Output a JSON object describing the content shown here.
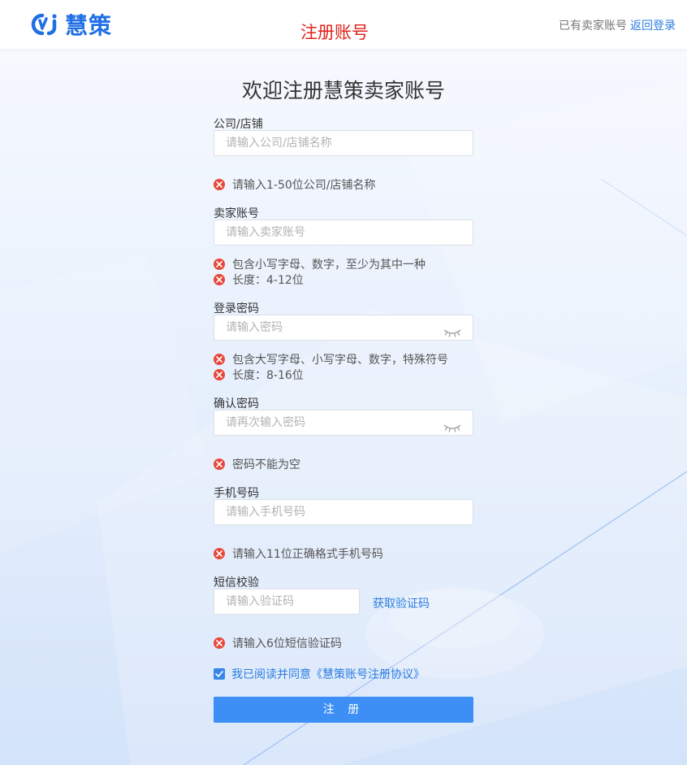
{
  "header": {
    "logo_text": "慧策",
    "title": "注册账号",
    "have_account_text": "已有卖家账号",
    "back_login_link": "返回登录"
  },
  "page_title": "欢迎注册慧策卖家账号",
  "fields": {
    "company": {
      "label": "公司/店铺",
      "placeholder": "请输入公司/店铺名称",
      "errors": [
        "请输入1-50位公司/店铺名称"
      ]
    },
    "account": {
      "label": "卖家账号",
      "placeholder": "请输入卖家账号",
      "errors": [
        "包含小写字母、数字，至少为其中一种",
        "长度：4-12位"
      ]
    },
    "password": {
      "label": "登录密码",
      "placeholder": "请输入密码",
      "errors": [
        "包含大写字母、小写字母、数字，特殊符号",
        "长度：8-16位"
      ]
    },
    "confirm_password": {
      "label": "确认密码",
      "placeholder": "请再次输入密码",
      "errors": [
        "密码不能为空"
      ]
    },
    "phone": {
      "label": "手机号码",
      "placeholder": "请输入手机号码",
      "errors": [
        "请输入11位正确格式手机号码"
      ]
    },
    "sms": {
      "label": "短信校验",
      "placeholder": "请输入验证码",
      "get_code_link": "获取验证码",
      "errors": [
        "请输入6位短信验证码"
      ]
    }
  },
  "agreement": {
    "checked": true,
    "text": "我已阅读并同意《慧策账号注册协议》"
  },
  "submit_label": "注 册",
  "colors": {
    "brand": "#1f6fe5",
    "header_title": "#e0221b",
    "link": "#2b7de1",
    "error_icon": "#e8483b",
    "button": "#3d8ff5"
  },
  "icons": [
    "logo-icon",
    "error-icon",
    "eye-closed-icon",
    "check-icon"
  ]
}
